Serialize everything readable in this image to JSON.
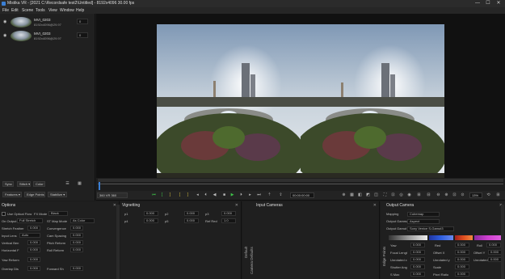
{
  "window": {
    "title": "Mistika VR - [2021 C:\\Recordsafe test2\\Untitled] - 8192x4096 30.00 fps",
    "minimize": "—",
    "maximize": "☐",
    "close": "✕"
  },
  "menu": [
    "File",
    "Edit",
    "Scene",
    "Tools",
    "View",
    "Window",
    "Help"
  ],
  "clips": [
    {
      "name": "MVI_0203",
      "meta": "8192x4096@29.97",
      "value": "0"
    },
    {
      "name": "MVI_0203",
      "meta": "8192x4096@29.97",
      "value": "0"
    }
  ],
  "left_controls": {
    "sync": "Sync ▾",
    "stitch": "Stitch ▾",
    "color": "Color ▾",
    "features": "Features ▾",
    "edge_points": "Edge Points ▾",
    "stabilize": "Stabilize ▾"
  },
  "transport": {
    "mode": "360 VR 360",
    "timecode": "00:00:00:00",
    "zoom": "13%"
  },
  "options": {
    "title": "Options",
    "rows": [
      {
        "a": "Use Optical Flow",
        "b": "FX Mode",
        "bval": "Black"
      },
      {
        "a": "On Output",
        "aval": "Full Stretch",
        "b": "ST Map Mode",
        "bval": "As Color"
      },
      {
        "a": "Stretch Feather",
        "aval": "0.000",
        "b": "Convergence",
        "bval": "0.000"
      },
      {
        "a": "Input Lens",
        "aval": "Auto",
        "b": "Cam Spacing",
        "bval": "0.000"
      },
      {
        "a": "Vertical Ben",
        "aval": "0.000",
        "b": "Pitch Reform",
        "bval": "0.000"
      },
      {
        "a": "Horizontal F",
        "aval": "0.000",
        "b": "Roll Reform",
        "bval": "0.000"
      },
      {
        "a": "Yaw Reform",
        "aval": "0.000",
        "b": "",
        "bval": ""
      },
      {
        "a": "Overlap Dis",
        "aval": "0.000",
        "b": "Forward Sh",
        "bval": "0.000"
      }
    ]
  },
  "vignetting": {
    "title": "Vignetting",
    "rows": [
      {
        "a": "p1",
        "aval": "0.000",
        "b": "p2",
        "bval": "0.000",
        "c": "p3",
        "cval": "0.000"
      },
      {
        "a": "p4",
        "aval": "0.000",
        "b": "p5",
        "bval": "0.000",
        "c": "Ref Red",
        "cval": "1.0"
      }
    ]
  },
  "input_cameras": {
    "title": "Input Cameras",
    "side_a": "Default",
    "side_b": "Camera Defaults"
  },
  "output_camera": {
    "title": "Output Camera",
    "side": "Edge Points",
    "mapping_label": "Mapping",
    "mapping": "Cubemap",
    "gamma_label": "Output Gamma",
    "gamma": "Aspect",
    "gamut_label": "Output Gamut",
    "gamut": "Sony Venice S-Gamut3",
    "rows": [
      {
        "a": "Yaw",
        "aval": "0.000",
        "b": "Red",
        "bval": "0.000",
        "c": "Roll",
        "cval": "0.000"
      },
      {
        "a": "Focal Lengt",
        "aval": "0.000",
        "b": "Offset X",
        "bval": "0.000",
        "c": "Offset Y",
        "cval": "0.000"
      },
      {
        "a": "Unrotated x",
        "aval": "0.000",
        "b": "Unrotated y",
        "bval": "0.000",
        "c": "Unrotated z",
        "cval": "0.000"
      },
      {
        "a": "Shutter Ang",
        "aval": "0.000",
        "b": "Scale",
        "bval": "0.000",
        "c": "",
        "cval": ""
      },
      {
        "a": "S Max",
        "aval": "0.000",
        "b": "Pixel Ratio",
        "bval": "0.000",
        "c": "",
        "cval": ""
      }
    ]
  },
  "colors": {
    "accent": "#3a7fd5",
    "background": "#1b1b1b",
    "play": "#3fc34a"
  }
}
